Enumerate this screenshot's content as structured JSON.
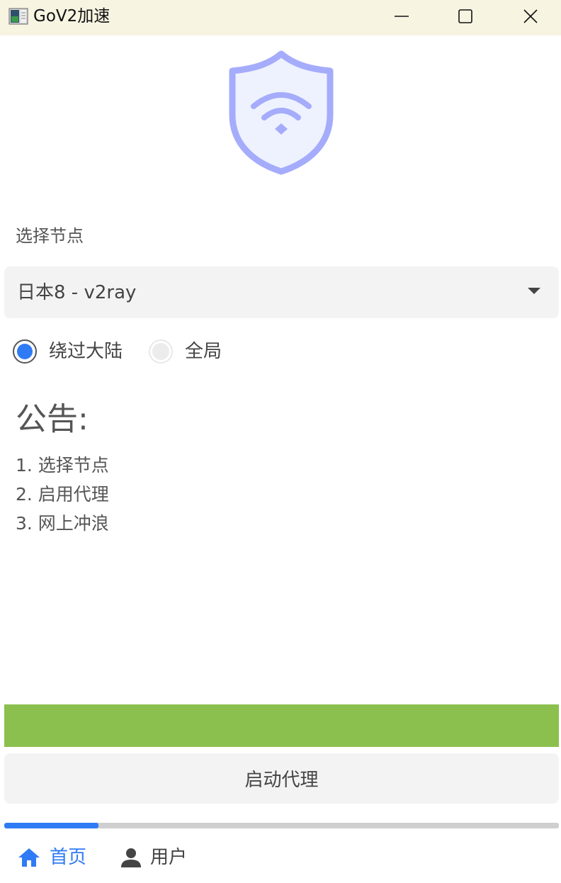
{
  "window": {
    "title": "GoV2加速",
    "app_icon": "app-icon",
    "controls": {
      "minimize_icon": "minimize-icon",
      "maximize_icon": "maximize-icon",
      "close_icon": "close-icon"
    }
  },
  "hero": {
    "icon": "shield-wifi-icon",
    "color": "#a5acfb"
  },
  "node_select": {
    "label": "选择节点",
    "selected": "日本8 - v2ray"
  },
  "mode": {
    "options": [
      {
        "label": "绕过大陆",
        "checked": true
      },
      {
        "label": "全局",
        "checked": false
      }
    ]
  },
  "notice": {
    "title": "公告:",
    "items": [
      "1. 选择节点",
      "2. 启用代理",
      "3. 网上冲浪"
    ]
  },
  "status_bar": {
    "color": "#8bc04e"
  },
  "start_button": {
    "label": "启动代理"
  },
  "progress": {
    "value": 0.17,
    "color": "#2f7bf5"
  },
  "nav": {
    "home": {
      "label": "首页",
      "icon": "home-icon",
      "active": true
    },
    "user": {
      "label": "用户",
      "icon": "user-icon",
      "active": false
    }
  },
  "colors": {
    "accent": "#2f7bf5",
    "titlebar": "#f7f4e2"
  }
}
